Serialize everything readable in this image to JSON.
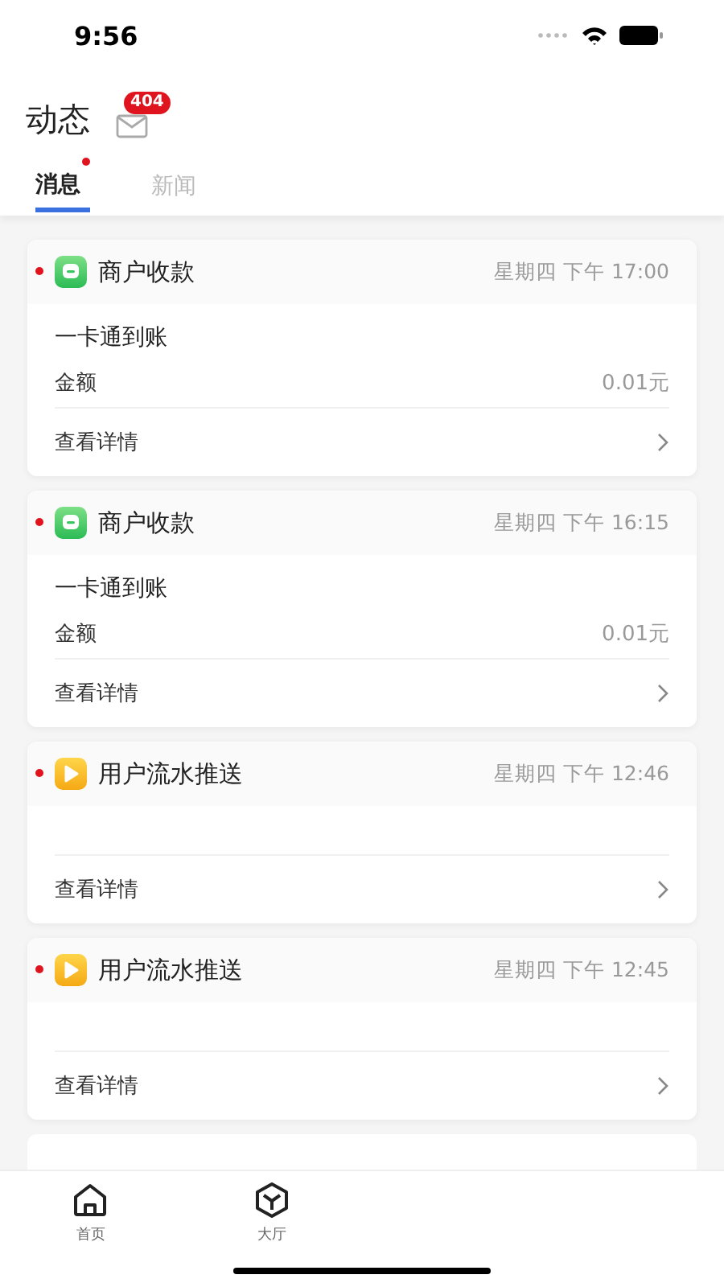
{
  "status_bar": {
    "time": "9:56"
  },
  "header": {
    "title": "动态",
    "mail_badge": "404"
  },
  "tabs": [
    {
      "label": "消息",
      "selected": true,
      "unread": true
    },
    {
      "label": "新闻",
      "selected": false,
      "unread": false
    }
  ],
  "messages": [
    {
      "kind": "merchant",
      "unread": true,
      "title": "商户收款",
      "time": "星期四 下午 17:00",
      "body": "一卡通到账",
      "field_label": "金额",
      "field_value": "0.01元",
      "link": "查看详情"
    },
    {
      "kind": "merchant",
      "unread": true,
      "title": "商户收款",
      "time": "星期四 下午 16:15",
      "body": "一卡通到账",
      "field_label": "金额",
      "field_value": "0.01元",
      "link": "查看详情"
    },
    {
      "kind": "flow",
      "unread": true,
      "title": "用户流水推送",
      "time": "星期四 下午 12:46",
      "link": "查看详情"
    },
    {
      "kind": "flow",
      "unread": true,
      "title": "用户流水推送",
      "time": "星期四 下午 12:45",
      "link": "查看详情"
    }
  ],
  "tab_bar": [
    {
      "kind": "home",
      "label": "首页",
      "selected": false
    },
    {
      "kind": "hall",
      "label": "大厅",
      "selected": false
    }
  ]
}
